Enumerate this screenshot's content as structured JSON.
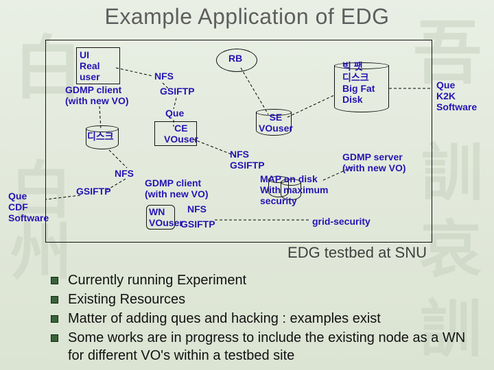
{
  "title": "Example Application of EDG",
  "caption": "EDG testbed at SNU",
  "deco": {
    "top_left": "白",
    "top_right": "吾",
    "right1": "訓",
    "right2": "哀",
    "right3": "訓",
    "left1": "白州"
  },
  "ui": {
    "l1": "UI",
    "l2": "Real",
    "l3": "user"
  },
  "gdmp_client_newvo": "GDMP client\n(with new VO)",
  "nfs": "NFS",
  "gsiftp": "GSIFTP",
  "que": "Que",
  "ce_vouser": "CE\nVOuser",
  "disk_kor": "디스크",
  "rb": "RB",
  "se_vouser": "SE\nVOuser",
  "nfs_gsiftp": "NFS\nGSIFTP",
  "gdmp_client_newvo2": "GDMP client\n(with new VO)",
  "wn_vouser": "WN\nVOuser",
  "map_block": "MAP on disk\nWith maximum\nsecurity",
  "gdmp_server": "GDMP server\n(with new VO)",
  "grid_sec": "grid-security",
  "big_disk": "빅 팻\n디스크\nBig Fat\nDisk",
  "que_k2k": "Que\nK2K\nSoftware",
  "que_cdf": "Que\nCDF\nSoftware",
  "bullets": [
    "Currently running Experiment",
    "Existing Resources",
    "Matter of adding ques and hacking : examples exist",
    "Some works are in progress to include the existing node as a WN for different VO's within a testbed site"
  ]
}
